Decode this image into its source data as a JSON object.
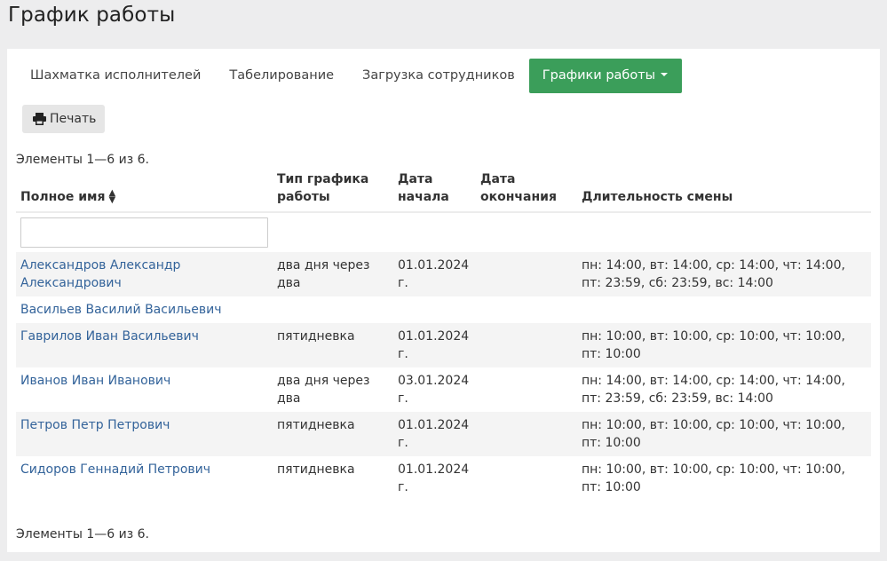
{
  "page": {
    "title": "График работы"
  },
  "tabs": [
    {
      "label": "Шахматка исполнителей",
      "active": false
    },
    {
      "label": "Табелирование",
      "active": false
    },
    {
      "label": "Загрузка сотрудников",
      "active": false
    },
    {
      "label": "Графики работы",
      "active": true
    }
  ],
  "toolbar": {
    "print_label": "Печать",
    "print_icon": "printer-icon"
  },
  "summary": {
    "top": "Элементы 1—6 из 6.",
    "bottom": "Элементы 1—6 из 6."
  },
  "table": {
    "headers": {
      "name": "Полное имя",
      "type_line1": "Тип графика",
      "type_line2": "работы",
      "start_line1": "Дата",
      "start_line2": "начала",
      "end_line1": "Дата",
      "end_line2": "окончания",
      "duration": "Длительность смены"
    },
    "filter": {
      "name_value": ""
    },
    "rows": [
      {
        "name": "Александров Александр Александрович",
        "type": "два дня через два",
        "start": "01.01.2024 г.",
        "end": "",
        "duration": "пн: 14:00, вт: 14:00, ср: 14:00, чт: 14:00, пт: 23:59, сб: 23:59, вс: 14:00"
      },
      {
        "name": "Васильев Василий Васильевич",
        "type": "",
        "start": "",
        "end": "",
        "duration": ""
      },
      {
        "name": "Гаврилов Иван Васильевич",
        "type": "пятидневка",
        "start": "01.01.2024 г.",
        "end": "",
        "duration": "пн: 10:00, вт: 10:00, ср: 10:00, чт: 10:00, пт: 10:00"
      },
      {
        "name": "Иванов Иван Иванович",
        "type": "два дня через два",
        "start": "03.01.2024 г.",
        "end": "",
        "duration": "пн: 14:00, вт: 14:00, ср: 14:00, чт: 14:00, пт: 23:59, сб: 23:59, вс: 14:00"
      },
      {
        "name": "Петров Петр Петрович",
        "type": "пятидневка",
        "start": "01.01.2024 г.",
        "end": "",
        "duration": "пн: 10:00, вт: 10:00, ср: 10:00, чт: 10:00, пт: 10:00"
      },
      {
        "name": "Сидоров Геннадий Петрович",
        "type": "пятидневка",
        "start": "01.01.2024 г.",
        "end": "",
        "duration": "пн: 10:00, вт: 10:00, ср: 10:00, чт: 10:00, пт: 10:00"
      }
    ]
  },
  "colors": {
    "accent": "#3b9e5a",
    "link": "#33639a",
    "background": "#ededee"
  }
}
